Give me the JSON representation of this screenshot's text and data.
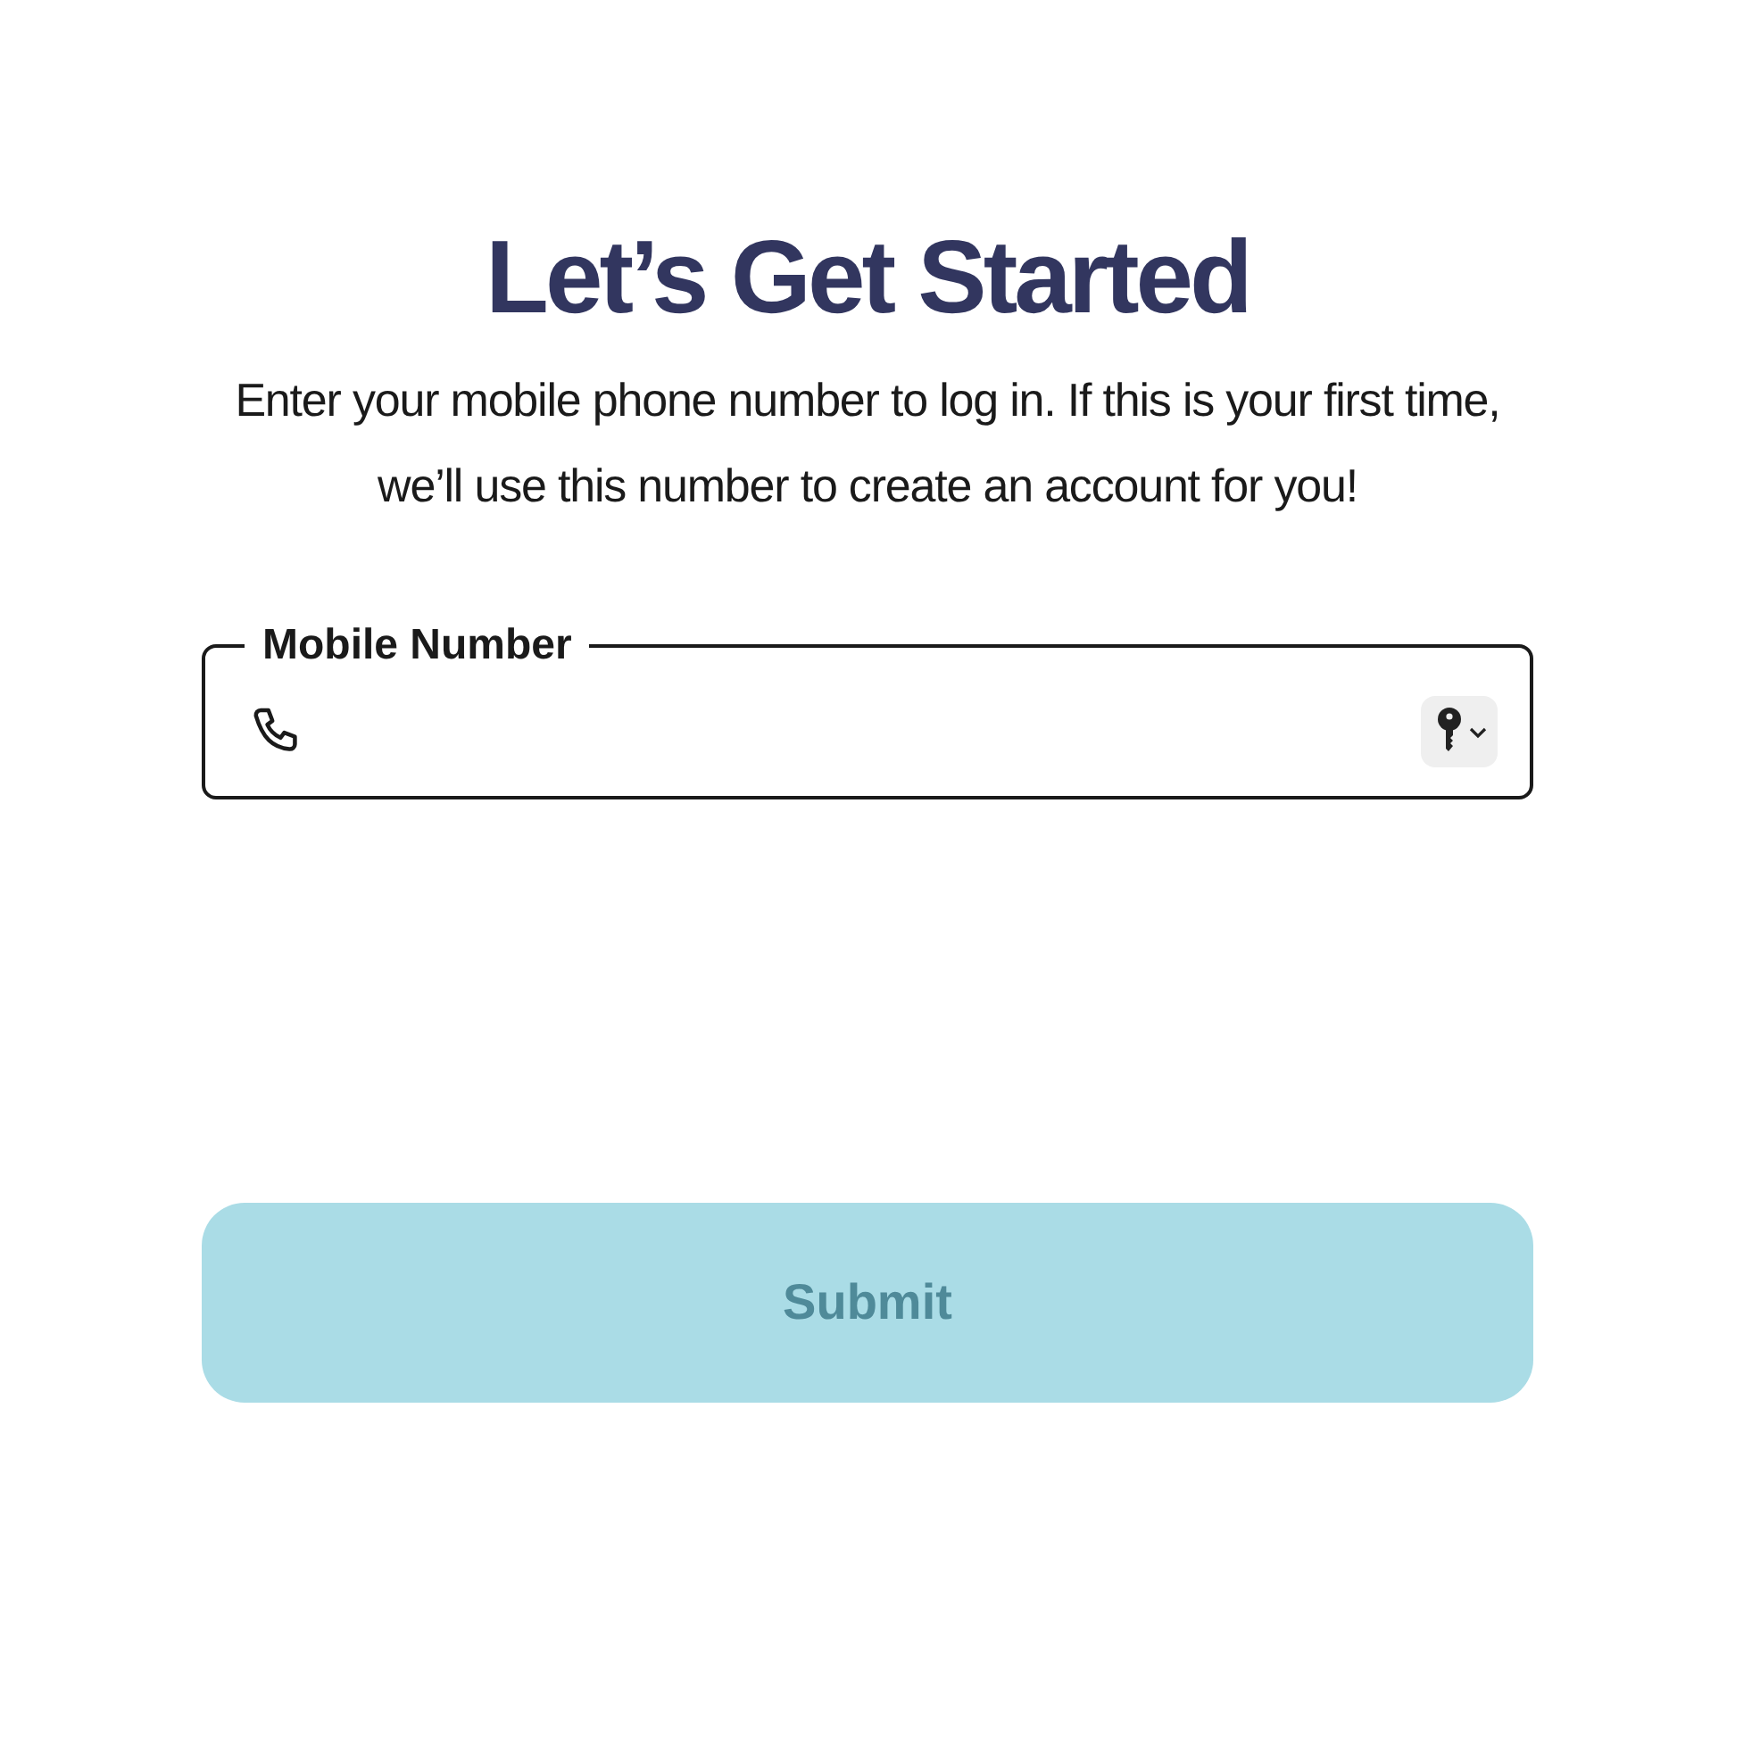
{
  "heading": "Let’s Get Started",
  "intro": "Enter your mobile phone number to log in. If this is your first time, we’ll use this number to create an account for you!",
  "mobile_field": {
    "label": "Mobile Number"
  },
  "submit_button": {
    "label": "Submit",
    "disabled": true
  }
}
